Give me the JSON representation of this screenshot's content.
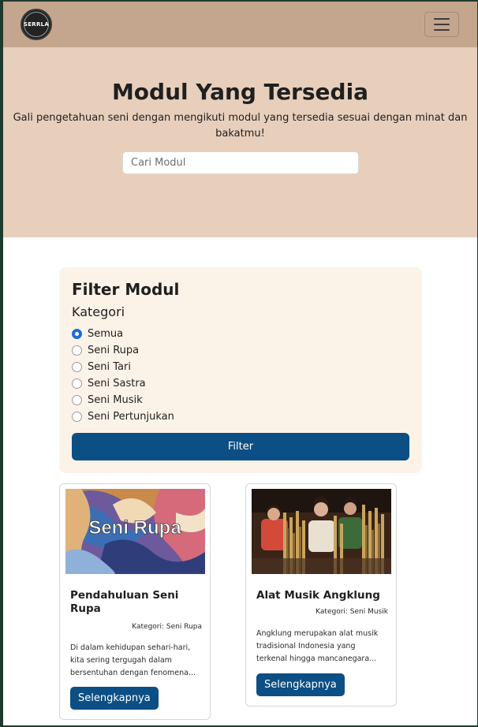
{
  "navbar": {
    "logo_text": "SERRLA",
    "menu_icon": "hamburger-menu-icon"
  },
  "hero": {
    "title": "Modul Yang Tersedia",
    "subtitle": "Gali pengetahuan seni dengan mengikuti modul yang tersedia sesuai dengan minat dan bakatmu!",
    "search_placeholder": "Cari Modul"
  },
  "filter": {
    "title": "Filter Modul",
    "category_label": "Kategori",
    "options": [
      "Semua",
      "Seni Rupa",
      "Seni Tari",
      "Seni Sastra",
      "Seni Musik",
      "Seni Pertunjukan"
    ],
    "selected": "Semua",
    "button_label": "Filter"
  },
  "cards": [
    {
      "image_text": "Seni Rupa",
      "title": "Pendahuluan Seni Rupa",
      "category": "Kategori: Seni Rupa",
      "description": "Di dalam kehidupan sehari-hari, kita sering tergugah dalam bersentuhan dengan fenomena...",
      "button_label": "Selengkapnya"
    },
    {
      "image_text": "",
      "title": "Alat Musik Angklung",
      "category": "Kategori: Seni Musik",
      "description": "Angklung merupakan alat musik tradisional Indonesia yang terkenal hingga mancanegara...",
      "button_label": "Selengkapnya"
    }
  ],
  "colors": {
    "navbar": "#c4a68e",
    "hero": "#e7cfbb",
    "filter_panel": "#fcf3e8",
    "primary_button": "#0c4f84",
    "radio_checked": "#1a6ddb"
  }
}
